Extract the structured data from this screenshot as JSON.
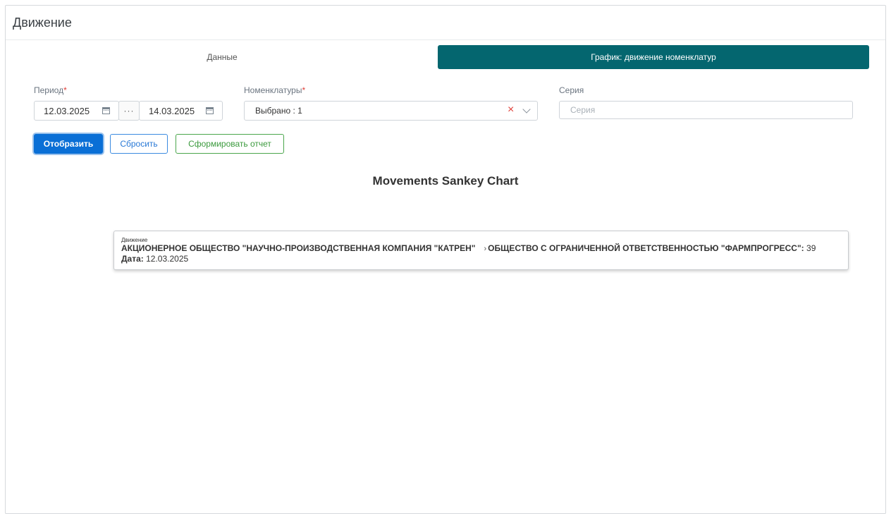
{
  "header": {
    "title": "Движение"
  },
  "tabs": [
    {
      "label": "Данные",
      "active": false
    },
    {
      "label": "График: движение номенклатур",
      "active": true
    }
  ],
  "filters": {
    "period": {
      "label": "Период",
      "required": "*",
      "from": "12.03.2025",
      "to": "14.03.2025",
      "separator": "···"
    },
    "nomenclatures": {
      "label": "Номенклатуры",
      "required": "*",
      "value": "Выбрано : 1",
      "clear": "×"
    },
    "series": {
      "label": "Серия",
      "placeholder": "Серия"
    }
  },
  "buttons": {
    "show": "Отобразить",
    "reset": "Сбросить",
    "report": "Сформировать отчет"
  },
  "chart": {
    "title": "Movements Sankey Chart",
    "tooltip": {
      "title": "Движение",
      "source": "АКЦИОНЕРНОЕ ОБЩЕСТВО \"НАУЧНО-ПРОИЗВОДСТВЕННАЯ КОМПАНИЯ \"КАТРЕН\"",
      "arrow": "›",
      "target": "ОБЩЕСТВО С ОГРАНИЧЕННОЙ ОТВЕТСТВЕННОСТЬЮ \"ФАРМПРОГРЕСС\"",
      "colon": ":",
      "value": "39",
      "date_label": "Дата:",
      "date": "12.03.2025"
    },
    "colors": {
      "main_flow": "#d46af5",
      "faint_flows": "#e8b8f6",
      "teal_flows": "#b5e6e9",
      "node_red": "#f7c9c9"
    }
  },
  "chart_data": {
    "type": "sankey",
    "title": "Movements Sankey Chart",
    "links": [
      {
        "source": "АКЦИОНЕРНОЕ ОБЩЕСТВО \"НАУЧНО-ПРОИЗВОДСТВЕННАЯ КОМПАНИЯ \"КАТРЕН\"",
        "target": "ОБЩЕСТВО С ОГРАНИЧЕННОЙ ОТВЕТСТВЕННОСТЬЮ \"ФАРМПРОГРЕСС\"",
        "value": 39,
        "date": "12.03.2025"
      }
    ]
  }
}
